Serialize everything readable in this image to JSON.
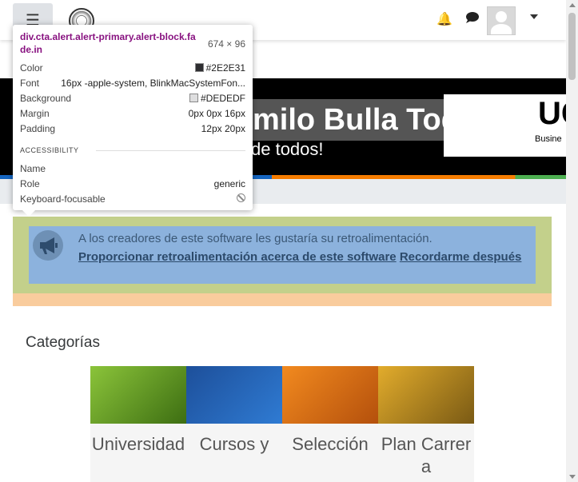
{
  "topbar": {
    "menu_icon": "hamburger-icon",
    "logo_icon": "site-logo",
    "notification_icon": "bell-icon",
    "message_icon": "chat-icon",
    "user_icon": "avatar",
    "dropdown_icon": "caret-down-icon"
  },
  "banner": {
    "title": "milo Bulla Toquica",
    "subtitle": "de todos!",
    "logo_big": "UC",
    "logo_small": "Busine"
  },
  "devtools": {
    "selector": "div.cta.alert.alert-primary.alert-block.fade.in",
    "size": "674 × 96",
    "rows": [
      {
        "key": "Color",
        "value": "#2E2E31"
      },
      {
        "key": "Font",
        "value": "16px -apple-system, BlinkMacSystemFon..."
      },
      {
        "key": "Background",
        "value": "#DEDEDF"
      },
      {
        "key": "Margin",
        "value": "0px 0px 16px"
      },
      {
        "key": "Padding",
        "value": "12px 20px"
      }
    ],
    "swatches": {
      "color": "#2E2E31",
      "background": "#DEDEDF"
    },
    "accessibility_heading": "ACCESSIBILITY",
    "acc_rows": [
      {
        "key": "Name",
        "value": ""
      },
      {
        "key": "Role",
        "value": "generic"
      },
      {
        "key": "Keyboard-focusable",
        "value": ""
      }
    ],
    "keyboard_icon": "not-allowed-icon"
  },
  "alert": {
    "icon": "megaphone-icon",
    "text": "A los creadores de este software les gustaría su retroalimentación.",
    "link_feedback": "Proporcionar retroalimentación acerca de este software",
    "link_later": "Recordarme después"
  },
  "categories": {
    "heading": "Categorías",
    "items": [
      {
        "label": "Universidad",
        "color": "#6a9a1f"
      },
      {
        "label": "Cursos y",
        "color": "#1f5aa8"
      },
      {
        "label": "Selección",
        "color": "#d9650f"
      },
      {
        "label": "Plan Carrera",
        "color": "#c7941a"
      }
    ]
  },
  "colors": {
    "alert_highlight": "#8cb2dd",
    "margin_highlight": "#c3d08b",
    "padding_highlight": "#f9cc9d"
  }
}
